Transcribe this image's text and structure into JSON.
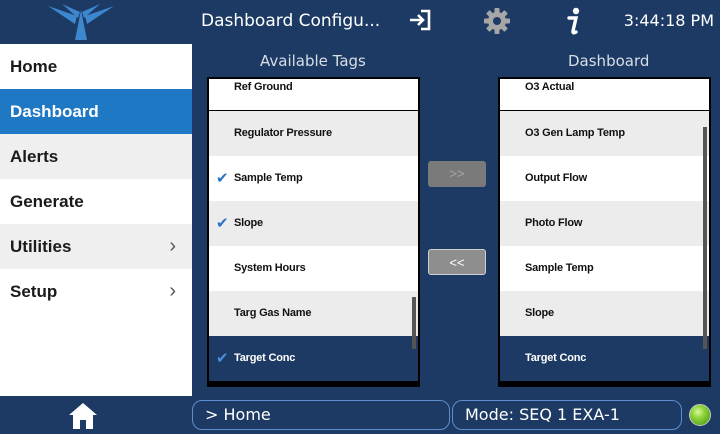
{
  "header": {
    "title": "Dashboard Configu...",
    "clock": "3:44:18 PM",
    "icons": [
      "teledyne-logo",
      "sign-in-icon",
      "gear-icon",
      "info-icon"
    ]
  },
  "sidebar": {
    "items": [
      {
        "label": "Home",
        "chevron": ""
      },
      {
        "label": "Dashboard",
        "chevron": ""
      },
      {
        "label": "Alerts",
        "chevron": ""
      },
      {
        "label": "Generate",
        "chevron": ""
      },
      {
        "label": "Utilities",
        "chevron": "›"
      },
      {
        "label": "Setup",
        "chevron": "›"
      }
    ],
    "active_index": 1
  },
  "available": {
    "title": "Available Tags",
    "rows": [
      {
        "label": "Ref Ground",
        "check": ""
      },
      {
        "label": "Regulator Pressure",
        "check": ""
      },
      {
        "label": "Sample Temp",
        "check": "✔"
      },
      {
        "label": "Slope",
        "check": "✔"
      },
      {
        "label": "System Hours",
        "check": ""
      },
      {
        "label": "Targ Gas Name",
        "check": ""
      },
      {
        "label": "Target Conc",
        "check": "✔"
      }
    ]
  },
  "dashboard": {
    "title": "Dashboard",
    "rows": [
      {
        "label": "O3 Actual"
      },
      {
        "label": "O3 Gen Lamp Temp"
      },
      {
        "label": "Output Flow"
      },
      {
        "label": "Photo Flow"
      },
      {
        "label": "Sample Temp"
      },
      {
        "label": "Slope"
      },
      {
        "label": "Target Conc"
      }
    ]
  },
  "buttons": {
    "add_label": ">>",
    "remove_label": "<<"
  },
  "footer": {
    "breadcrumb": "> Home",
    "mode": "Mode: SEQ 1 EXA-1",
    "status_color": "#8fd43a"
  },
  "colors": {
    "navy": "#1c3a63",
    "accent": "#1e78c4"
  }
}
